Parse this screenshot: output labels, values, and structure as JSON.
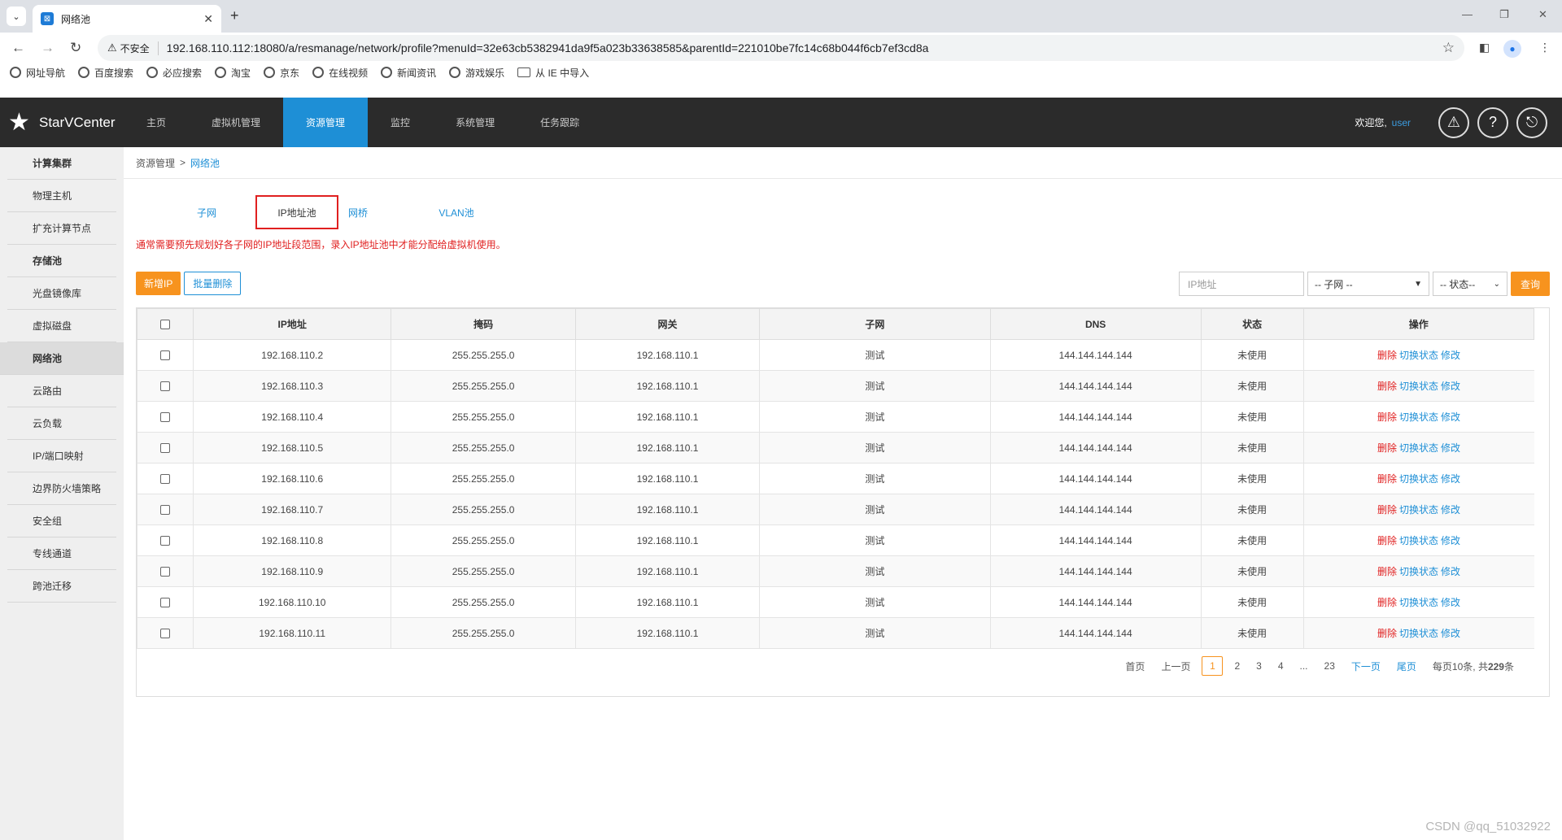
{
  "browser": {
    "tab_title": "网络池",
    "favicon": "⊠",
    "security_label": "不安全",
    "url": "192.168.110.112:18080/a/resmanage/network/profile?menuId=32e63cb5382941da9f5a023b33638585&parentId=221010be7fc14c68b044f6cb7ef3cd8a",
    "bookmarks": [
      {
        "label": "网址导航"
      },
      {
        "label": "百度搜索"
      },
      {
        "label": "必应搜索"
      },
      {
        "label": "淘宝"
      },
      {
        "label": "京东"
      },
      {
        "label": "在线视频"
      },
      {
        "label": "新闻资讯"
      },
      {
        "label": "游戏娱乐"
      },
      {
        "label": "从 IE 中导入",
        "folder": true
      }
    ]
  },
  "app": {
    "logo_text": "StarVCenter",
    "nav": [
      "主页",
      "虚拟机管理",
      "资源管理",
      "监控",
      "系统管理",
      "任务跟踪"
    ],
    "nav_active_index": 2,
    "welcome": "欢迎您,",
    "username": "user",
    "header_icons": [
      "alert-icon",
      "help-icon",
      "logout-icon"
    ]
  },
  "sidebar": {
    "items": [
      {
        "label": "计算集群",
        "bold": true
      },
      {
        "label": "物理主机"
      },
      {
        "label": "扩充计算节点"
      },
      {
        "label": "存储池",
        "bold": true
      },
      {
        "label": "光盘镜像库"
      },
      {
        "label": "虚拟磁盘"
      },
      {
        "label": "网络池",
        "active": true
      },
      {
        "label": "云路由"
      },
      {
        "label": "云负载"
      },
      {
        "label": "IP/端口映射"
      },
      {
        "label": "边界防火墙策略"
      },
      {
        "label": "安全组"
      },
      {
        "label": "专线通道"
      },
      {
        "label": "跨池迁移"
      }
    ]
  },
  "breadcrumb": {
    "root": "资源管理",
    "sep": ">",
    "current": "网络池"
  },
  "tabs": [
    "子网",
    "IP地址池",
    "网桥",
    "VLAN池"
  ],
  "tab_active_index": 1,
  "notice": "通常需要预先规划好各子网的IP地址段范围，录入IP地址池中才能分配给虚拟机使用。",
  "toolbar": {
    "add_label": "新增IP",
    "batch_delete_label": "批量删除"
  },
  "filters": {
    "ip_placeholder": "IP地址",
    "subnet_value": "-- 子网 --",
    "status_value": "-- 状态--",
    "search_label": "查询"
  },
  "table": {
    "headers": [
      "IP地址",
      "掩码",
      "网关",
      "子网",
      "DNS",
      "状态",
      "操作"
    ],
    "rows": [
      [
        "192.168.110.2",
        "255.255.255.0",
        "192.168.110.1",
        "测试",
        "144.144.144.144",
        "未使用"
      ],
      [
        "192.168.110.3",
        "255.255.255.0",
        "192.168.110.1",
        "测试",
        "144.144.144.144",
        "未使用"
      ],
      [
        "192.168.110.4",
        "255.255.255.0",
        "192.168.110.1",
        "测试",
        "144.144.144.144",
        "未使用"
      ],
      [
        "192.168.110.5",
        "255.255.255.0",
        "192.168.110.1",
        "测试",
        "144.144.144.144",
        "未使用"
      ],
      [
        "192.168.110.6",
        "255.255.255.0",
        "192.168.110.1",
        "测试",
        "144.144.144.144",
        "未使用"
      ],
      [
        "192.168.110.7",
        "255.255.255.0",
        "192.168.110.1",
        "测试",
        "144.144.144.144",
        "未使用"
      ],
      [
        "192.168.110.8",
        "255.255.255.0",
        "192.168.110.1",
        "测试",
        "144.144.144.144",
        "未使用"
      ],
      [
        "192.168.110.9",
        "255.255.255.0",
        "192.168.110.1",
        "测试",
        "144.144.144.144",
        "未使用"
      ],
      [
        "192.168.110.10",
        "255.255.255.0",
        "192.168.110.1",
        "测试",
        "144.144.144.144",
        "未使用"
      ],
      [
        "192.168.110.11",
        "255.255.255.0",
        "192.168.110.1",
        "测试",
        "144.144.144.144",
        "未使用"
      ]
    ],
    "ops": {
      "delete": "删除",
      "toggle": "切换状态",
      "edit": "修改"
    }
  },
  "pager": {
    "first": "首页",
    "prev": "上一页",
    "pages": [
      "1",
      "2",
      "3",
      "4",
      "...",
      "23"
    ],
    "current": "1",
    "next": "下一页",
    "last": "尾页",
    "summary_prefix": "每页10条, 共",
    "total": "229",
    "summary_suffix": "条"
  },
  "watermark": "CSDN @qq_51032922",
  "colors": {
    "accent": "#1e8fd6",
    "orange": "#f7931e",
    "danger": "#e02020",
    "nav_bg": "#2b2b2b"
  }
}
